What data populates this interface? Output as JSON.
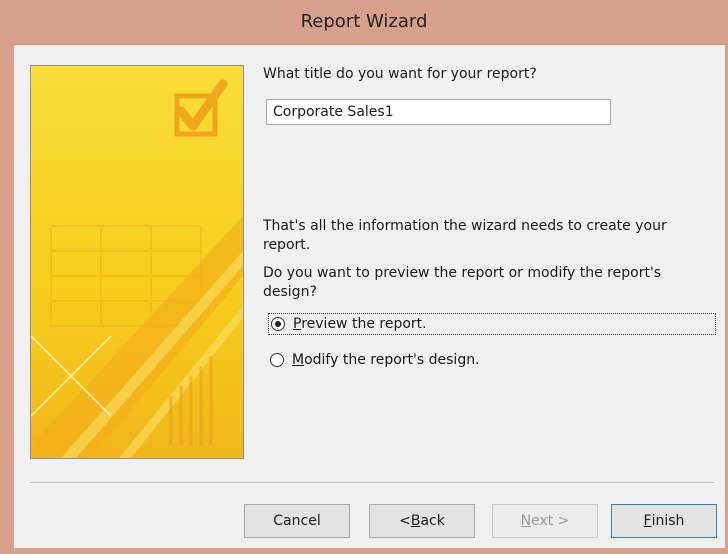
{
  "window": {
    "title": "Report Wizard"
  },
  "wizard": {
    "title_question": "What title do you want for your report?",
    "report_title_value": "Corporate Sales1",
    "info_text": "That's all the information the wizard needs to create your report.",
    "preview_question": "Do you want to preview the report or modify the report's design?"
  },
  "options": [
    {
      "prefix": "",
      "accel": "P",
      "rest": "review the report.",
      "selected": true
    },
    {
      "prefix": "",
      "accel": "M",
      "rest": "odify the report's design.",
      "selected": false
    }
  ],
  "buttons": {
    "cancel": {
      "label": "Cancel"
    },
    "back": {
      "prefix": "< ",
      "accel": "B",
      "rest": "ack"
    },
    "next": {
      "accel": "N",
      "rest": "ext >",
      "enabled": false
    },
    "finish": {
      "accel": "F",
      "rest": "inish"
    }
  },
  "colors": {
    "titlebar": "#d8a08a",
    "art_yellow": "#f7d21f",
    "art_orange": "#f0a51a"
  },
  "icons": {
    "wizard_art": "checkbox-checkmark-icon"
  }
}
